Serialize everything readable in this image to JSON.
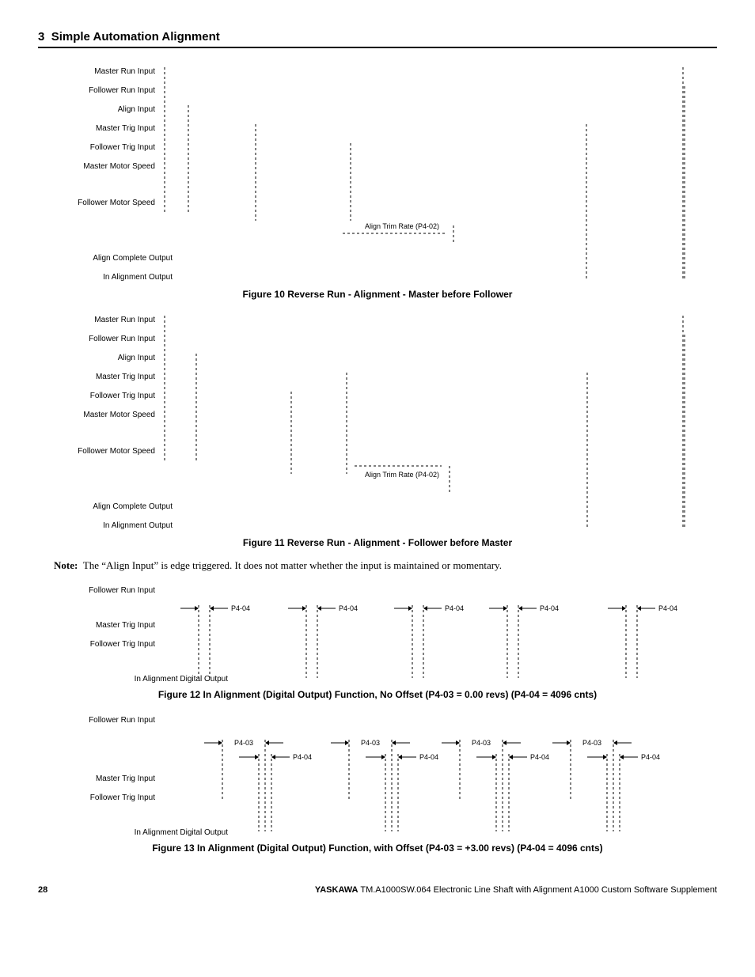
{
  "section": {
    "number": "3",
    "title": "Simple Automation Alignment"
  },
  "labels": {
    "master_run_input": "Master Run Input",
    "follower_run_input": "Follower Run Input",
    "align_input": "Align Input",
    "master_trig_input": "Master Trig Input",
    "follower_trig_input": "Follower Trig Input",
    "master_motor_speed": "Master Motor Speed",
    "follower_motor_speed": "Follower Motor Speed",
    "align_complete_output": "Align Complete Output",
    "in_alignment_output": "In Alignment Output",
    "in_alignment_digital_output": "In Alignment Digital Output",
    "align_trim_rate": "Align Trim Rate (P4-02)",
    "p4_03": "P4-03",
    "p4_04": "P4-04"
  },
  "captions": {
    "fig10": "Figure 10  Reverse Run - Alignment - Master before Follower",
    "fig11": "Figure 11  Reverse Run - Alignment - Follower before Master",
    "fig12": "Figure 12  In Alignment (Digital Output) Function, No Offset (P4-03 = 0.00 revs) (P4-04 = 4096 cnts)",
    "fig13": "Figure 13  In Alignment (Digital Output) Function, with Offset (P4-03 = +3.00 revs) (P4-04 = 4096 cnts)"
  },
  "note": {
    "label": "Note:",
    "text": "The “Align Input” is edge triggered. It does not matter whether the input is maintained or momentary."
  },
  "footer": {
    "page": "28",
    "brand": "YASKAWA",
    "doc": "TM.A1000SW.064 Electronic Line Shaft with Alignment A1000 Custom Software Supplement"
  },
  "chart_data": [
    {
      "figure": 10,
      "type": "timing-diagram",
      "title": "Reverse Run - Alignment - Master before Follower",
      "annotation": "Align Trim Rate (P4-02)",
      "signals": [
        {
          "name": "Master Run Input",
          "kind": "digital"
        },
        {
          "name": "Follower Run Input",
          "kind": "digital"
        },
        {
          "name": "Align Input",
          "kind": "digital-pulse"
        },
        {
          "name": "Master Trig Input",
          "kind": "digital-pulse"
        },
        {
          "name": "Follower Trig Input",
          "kind": "digital-pulse"
        },
        {
          "name": "Master Motor Speed",
          "kind": "analog-ramp"
        },
        {
          "name": "Follower Motor Speed",
          "kind": "analog-ramp-with-dip"
        },
        {
          "name": "Align Complete Output",
          "kind": "digital"
        },
        {
          "name": "In Alignment Output",
          "kind": "digital"
        }
      ]
    },
    {
      "figure": 11,
      "type": "timing-diagram",
      "title": "Reverse Run - Alignment - Follower before Master",
      "annotation": "Align Trim Rate (P4-02)",
      "signals": [
        {
          "name": "Master Run Input",
          "kind": "digital"
        },
        {
          "name": "Follower Run Input",
          "kind": "digital"
        },
        {
          "name": "Align Input",
          "kind": "digital-pulse"
        },
        {
          "name": "Master Trig Input",
          "kind": "digital-pulse"
        },
        {
          "name": "Follower Trig Input",
          "kind": "digital-pulse"
        },
        {
          "name": "Master Motor Speed",
          "kind": "analog-ramp"
        },
        {
          "name": "Follower Motor Speed",
          "kind": "analog-ramp-with-dip"
        },
        {
          "name": "Align Complete Output",
          "kind": "digital"
        },
        {
          "name": "In Alignment Output",
          "kind": "digital"
        }
      ]
    },
    {
      "figure": 12,
      "type": "timing-diagram",
      "title": "In Alignment (Digital Output) Function, No Offset",
      "parameters": {
        "P4-03": "0.00 revs",
        "P4-04": "4096 cnts"
      },
      "window_label": "P4-04",
      "signals": [
        {
          "name": "Follower Run Input",
          "kind": "digital"
        },
        {
          "name": "Master Trig Input",
          "kind": "digital-pulse"
        },
        {
          "name": "Follower Trig Input",
          "kind": "digital-pulse"
        },
        {
          "name": "In Alignment Digital Output",
          "kind": "digital"
        }
      ]
    },
    {
      "figure": 13,
      "type": "timing-diagram",
      "title": "In Alignment (Digital Output) Function, with Offset",
      "parameters": {
        "P4-03": "+3.00 revs",
        "P4-04": "4096 cnts"
      },
      "window_labels": [
        "P4-03",
        "P4-04"
      ],
      "signals": [
        {
          "name": "Follower Run Input",
          "kind": "digital"
        },
        {
          "name": "Master Trig Input",
          "kind": "digital-pulse"
        },
        {
          "name": "Follower Trig Input",
          "kind": "digital-pulse"
        },
        {
          "name": "In Alignment Digital Output",
          "kind": "digital"
        }
      ]
    }
  ]
}
